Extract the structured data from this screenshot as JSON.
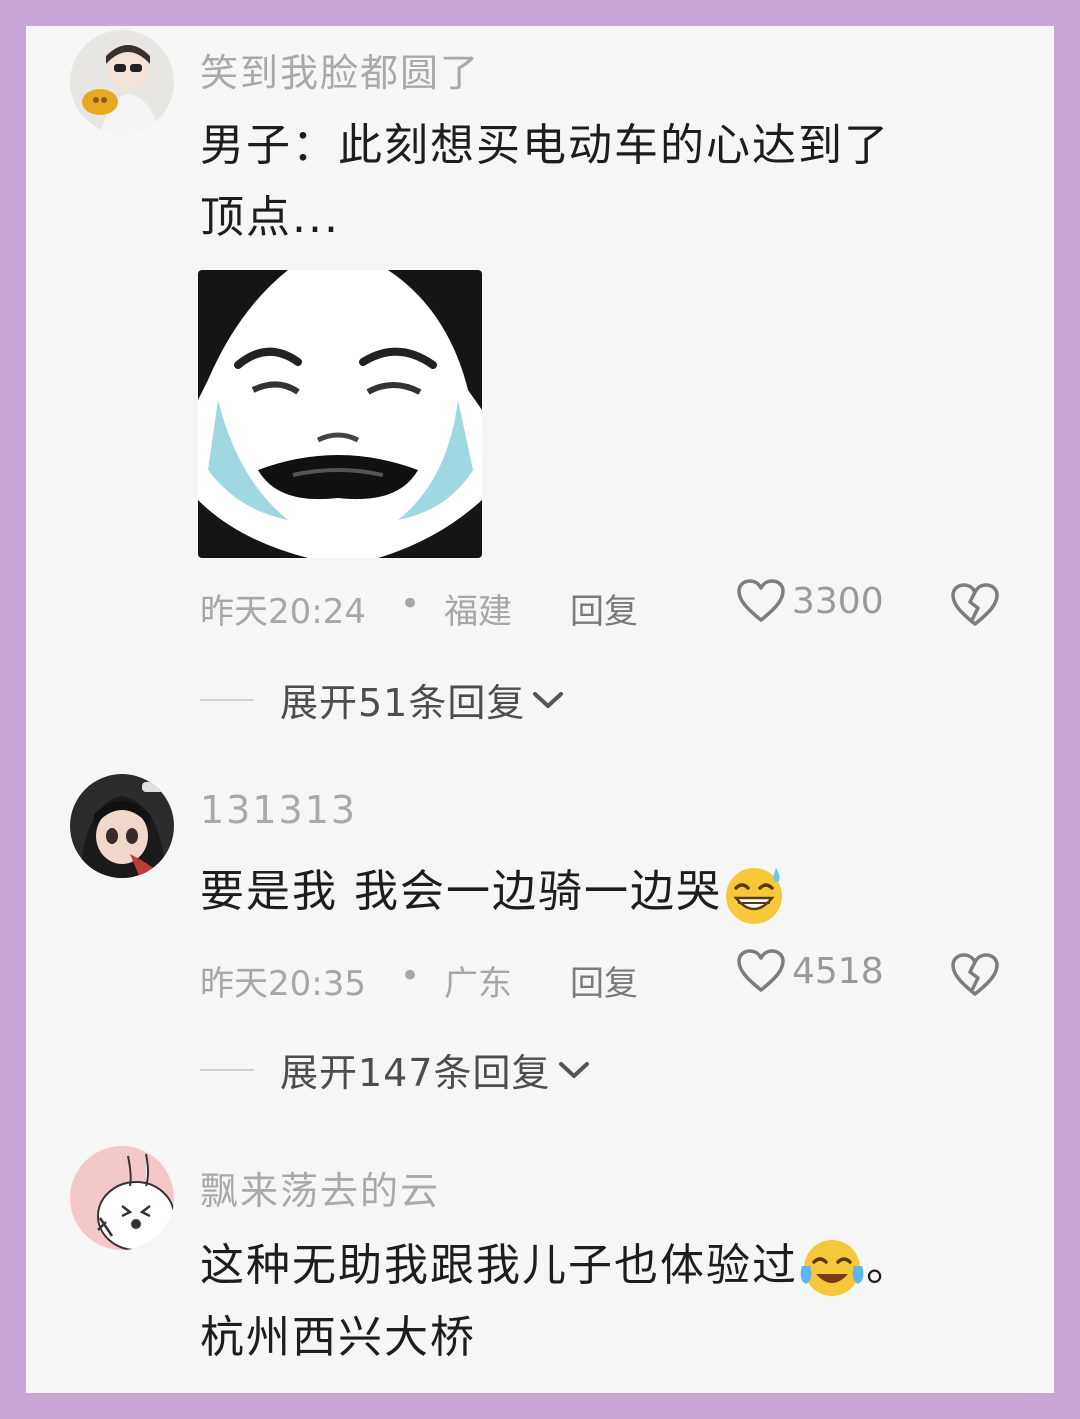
{
  "comments": [
    {
      "username": "笑到我脸都圆了",
      "text_line1": "男子：此刻想买电动车的心达到了",
      "text_line2": "顶点...",
      "time": "昨天20:24",
      "dot": "•",
      "location": "福建",
      "reply": "回复",
      "likes": "3300",
      "expand": "展开51条回复"
    },
    {
      "username": "131313",
      "text_line1": "要是我 我会一边骑一边哭",
      "time": "昨天20:35",
      "dot": "•",
      "location": "广东",
      "reply": "回复",
      "likes": "4518",
      "expand": "展开147条回复"
    },
    {
      "username": "飘来荡去的云",
      "text_line1": "这种无助我跟我儿子也体验过",
      "text_line1_end": "。",
      "text_line2": "杭州西兴大桥"
    }
  ],
  "icons": {
    "like": "heart-outline-icon",
    "dislike": "broken-heart-icon",
    "expand": "chevron-down-icon",
    "emoji_sweat": "grinning-sweat-emoji",
    "emoji_tears": "tears-of-joy-emoji"
  },
  "colors": {
    "page_border": "#c9a6d8",
    "background": "#f6f6f6",
    "username": "#a9a9a9",
    "body_text": "#1d1d1d"
  }
}
